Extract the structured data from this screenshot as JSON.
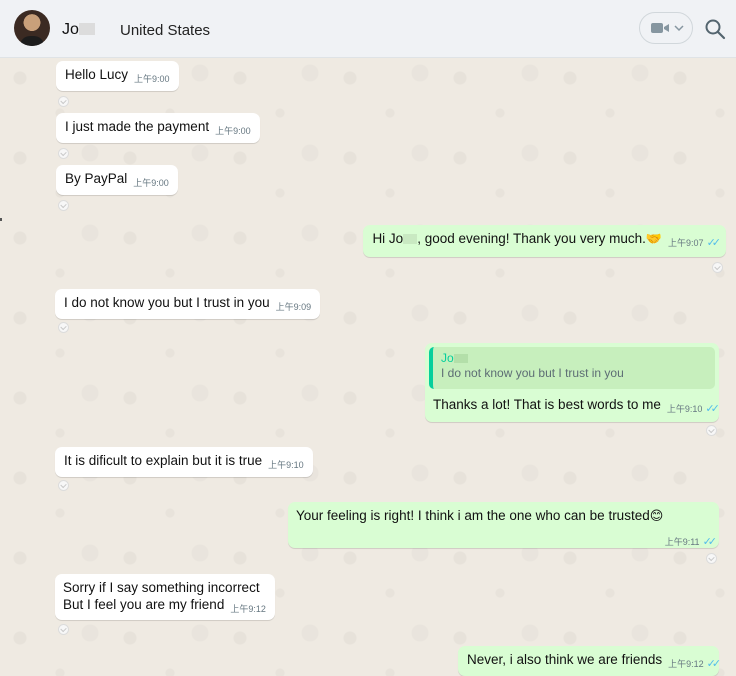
{
  "header": {
    "contact_name": "Jo",
    "contact_country": "United States"
  },
  "icons": {
    "video": "video-call-icon",
    "chevron": "chevron-down-icon",
    "search": "search-icon"
  },
  "colors": {
    "incoming_bubble": "#ffffff",
    "outgoing_bubble": "#d9fdd3",
    "read_ticks": "#53bdeb",
    "quote_accent": "#06cf9c"
  },
  "messages": [
    {
      "direction": "in",
      "text": "Hello Lucy",
      "time": "上午9:00"
    },
    {
      "direction": "in",
      "text": "I just made the payment",
      "time": "上午9:00"
    },
    {
      "direction": "in",
      "text": "By PayPal",
      "time": "上午9:00"
    },
    {
      "direction": "out",
      "text_before": "Hi Jo",
      "text_after": ", good evening! Thank you very much.",
      "emoji": "🤝",
      "time": "上午9:07",
      "ticks": "✓✓"
    },
    {
      "direction": "in",
      "text": "I do not know you but I trust in you",
      "time": "上午9:09"
    },
    {
      "direction": "out",
      "quote_author": "Jo",
      "quote_text": "I do not know you but I trust in you",
      "text": "Thanks a lot! That is best words to me",
      "time": "上午9:10",
      "ticks": "✓✓"
    },
    {
      "direction": "in",
      "text": "It is dificult to explain but it is true",
      "time": "上午9:10"
    },
    {
      "direction": "out",
      "text": "Your feeling is right! I think i am the one who can be trusted",
      "emoji": "😊",
      "time": "上午9:11",
      "ticks": "✓✓"
    },
    {
      "direction": "in",
      "line1": "Sorry if  I  say something incorrect",
      "line2": "But I  feel you are my friend",
      "time": "上午9:12"
    },
    {
      "direction": "out",
      "text": "Never, i also think we are friends",
      "time": "上午9:12",
      "ticks": "✓✓"
    }
  ]
}
